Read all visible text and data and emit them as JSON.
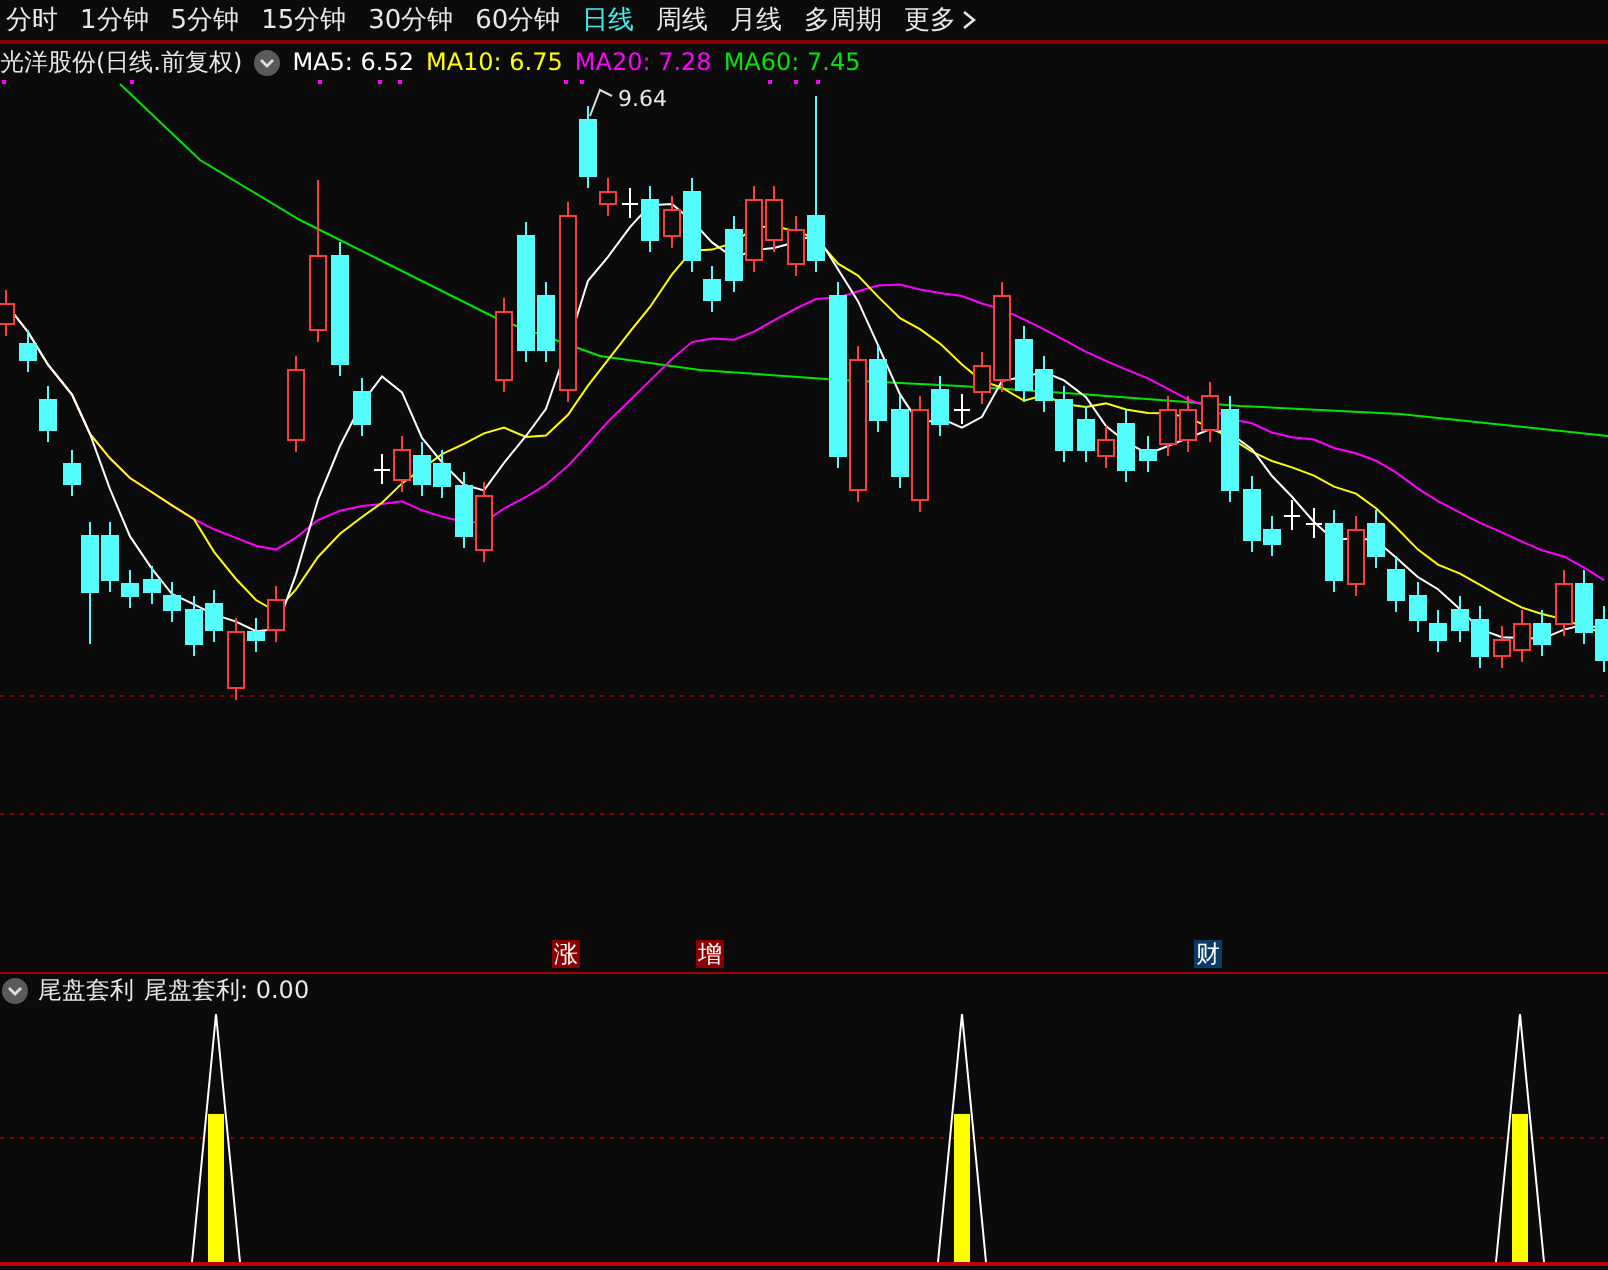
{
  "period_tabs": [
    {
      "label": "分时",
      "selected": false
    },
    {
      "label": "1分钟",
      "selected": false
    },
    {
      "label": "5分钟",
      "selected": false
    },
    {
      "label": "15分钟",
      "selected": false
    },
    {
      "label": "30分钟",
      "selected": false
    },
    {
      "label": "60分钟",
      "selected": false
    },
    {
      "label": "日线",
      "selected": true
    },
    {
      "label": "周线",
      "selected": false
    },
    {
      "label": "月线",
      "selected": false
    },
    {
      "label": "多周期",
      "selected": false
    },
    {
      "label": "更多",
      "selected": false
    }
  ],
  "chart_title": "光洋股份(日线.前复权)",
  "moving_averages": [
    {
      "label": "MA5: 6.52",
      "color": "#ffffff"
    },
    {
      "label": "MA10: 6.75",
      "color": "#ffff00"
    },
    {
      "label": "MA20: 7.28",
      "color": "#ff00ff"
    },
    {
      "label": "MA60: 7.45",
      "color": "#00e600"
    }
  ],
  "high_label": "9.64",
  "event_markers": [
    {
      "label": "涨",
      "color": "#8b0000"
    },
    {
      "label": "增",
      "color": "#8b0000"
    },
    {
      "label": "财",
      "color": "#0a3a6a"
    }
  ],
  "indicator": {
    "name": "尾盘套利",
    "value": "尾盘套利: 0.00"
  }
}
